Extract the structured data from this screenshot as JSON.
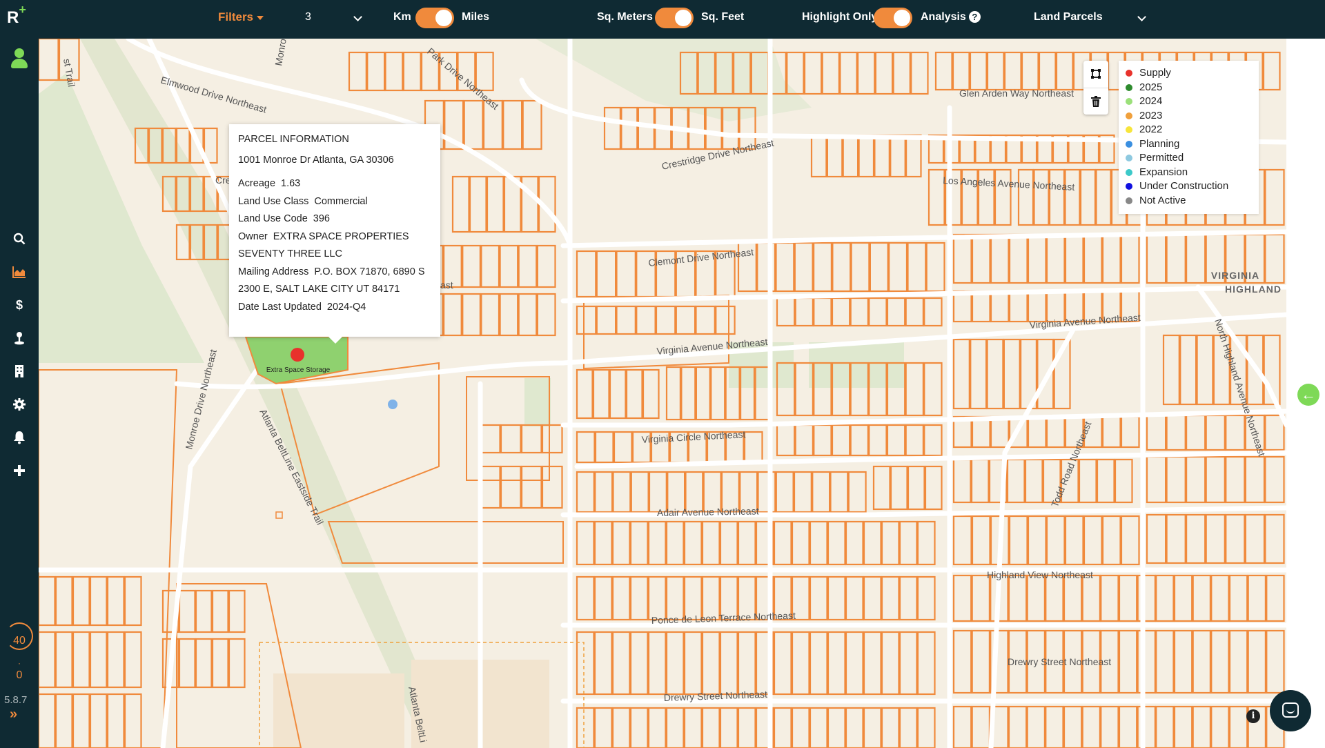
{
  "app": {
    "logo": "R",
    "logo_plus": "+",
    "version": "5.8.7"
  },
  "topbar": {
    "filters_label": "Filters",
    "count_value": "3",
    "km_label": "Km",
    "miles_label": "Miles",
    "sqm_label": "Sq. Meters",
    "sqft_label": "Sq. Feet",
    "highlight_label": "Highlight Only",
    "analysis_label": "Analysis",
    "help_glyph": "?",
    "layer_value": "Land Parcels"
  },
  "sidebar": {
    "counter_top": "40",
    "counter_bottom": "0",
    "expand_glyph": "»",
    "icons": [
      "user-icon",
      "search-icon",
      "chart-icon",
      "dollar-icon",
      "pin-icon",
      "building-icon",
      "gear-icon",
      "bell-icon",
      "plus-icon"
    ]
  },
  "popup": {
    "title": "PARCEL INFORMATION",
    "address": "1001 Monroe Dr Atlanta, GA 30306",
    "fields": [
      {
        "label": "Acreage",
        "value": "1.63"
      },
      {
        "label": "Land Use Class",
        "value": "Commercial"
      },
      {
        "label": "Land Use Code",
        "value": "396"
      },
      {
        "label": "Owner",
        "value": "EXTRA SPACE PROPERTIES SEVENTY THREE LLC"
      },
      {
        "label": "Mailing Address",
        "value": "P.O. BOX 71870, 6890 S 2300 E, SALT LAKE CITY UT 84171"
      },
      {
        "label": "Date Last Updated",
        "value": "2024-Q4"
      }
    ]
  },
  "marker": {
    "label": "Extra Space Storage",
    "color": "#e8322c"
  },
  "legend": [
    {
      "label": "Supply",
      "color": "#e8322c"
    },
    {
      "label": "2025",
      "color": "#2e8b2e"
    },
    {
      "label": "2024",
      "color": "#9be07a"
    },
    {
      "label": "2023",
      "color": "#f0a03c"
    },
    {
      "label": "2022",
      "color": "#f7e53b"
    },
    {
      "label": "Planning",
      "color": "#3a8fe0"
    },
    {
      "label": "Permitted",
      "color": "#8ec9e0"
    },
    {
      "label": "Expansion",
      "color": "#3cc9c9"
    },
    {
      "label": "Under Construction",
      "color": "#1010e0"
    },
    {
      "label": "Not Active",
      "color": "#888888"
    }
  ],
  "map": {
    "parcel_color": "#f08a3c",
    "streets": [
      "st Trail",
      "Elmwood Drive Northeast",
      "Monroe Drive",
      "Park Drive Northeast",
      "Glen Arden Way Northeast",
      "Crestridge Drive Northeast",
      "Los Angeles Avenue Northeast",
      "Clemont Drive Northeast",
      "Virginia Avenue Northeast",
      "Virginia Avenue Northeast",
      "Monroe Drive Northeast",
      "Atlanta BeltLine Eastside Trail",
      "Virginia Circle Northeast",
      "Adair Avenue Northeast",
      "Todd Road Northeast",
      "North Highland Avenue Northeast",
      "Highland View Northeast",
      "Ponce de Leon Terrace Northeast",
      "Drewry Street Northeast",
      "Drewry Street Northeast",
      "Atlanta BeltLi",
      "Cre",
      "ast"
    ],
    "area": [
      "VIRGINIA",
      "HIGHLAND"
    ]
  }
}
